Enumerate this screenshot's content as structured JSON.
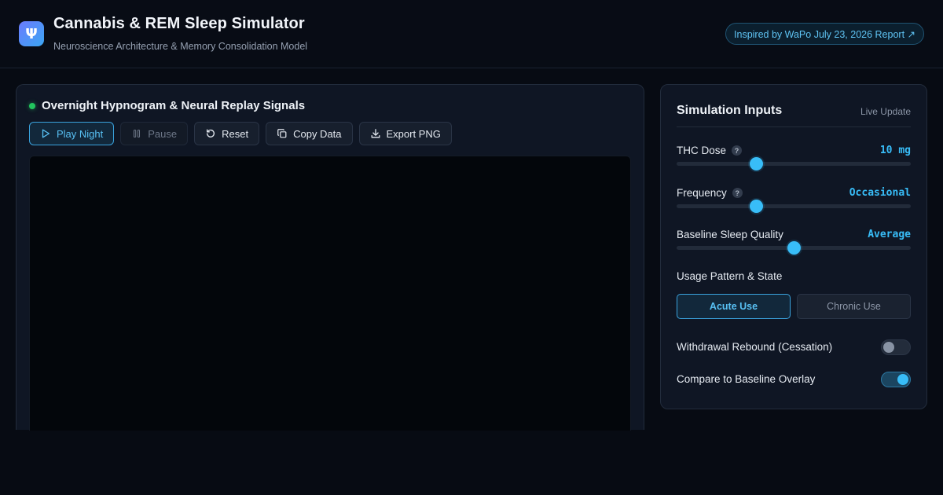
{
  "header": {
    "logo_glyph": "Ψ",
    "title": "Cannabis & REM Sleep Simulator",
    "subtitle": "Neuroscience Architecture & Memory Consolidation Model",
    "source_link": "Inspired by WaPo July 23, 2026 Report ↗"
  },
  "visualization": {
    "title": "Overnight Hypnogram & Neural Replay Signals",
    "status_color": "#22c55e",
    "buttons": {
      "play": "Play Night",
      "pause": "Pause",
      "reset": "Reset",
      "copy": "Copy Data",
      "export": "Export PNG"
    }
  },
  "inputs": {
    "title": "Simulation Inputs",
    "live_label": "Live Update",
    "thc_dose": {
      "label": "THC Dose",
      "help": "?",
      "value": "10 mg",
      "level": 0.34
    },
    "frequency": {
      "label": "Frequency",
      "help": "?",
      "value": "Occasional",
      "level": 0.34
    },
    "baseline_quality": {
      "label": "Baseline Sleep Quality",
      "value": "Average",
      "level": 0.5
    },
    "usage_pattern": {
      "label": "Usage Pattern & State",
      "options": [
        "Acute Use",
        "Chronic Use"
      ],
      "selected": "Acute Use"
    },
    "withdrawal": {
      "label": "Withdrawal Rebound (Cessation)",
      "on": false
    },
    "baseline_overlay": {
      "label": "Compare to Baseline Overlay",
      "on": true
    }
  },
  "colors": {
    "accent": "#38bdf8",
    "background": "#070b13",
    "panel": "#0f1624"
  }
}
